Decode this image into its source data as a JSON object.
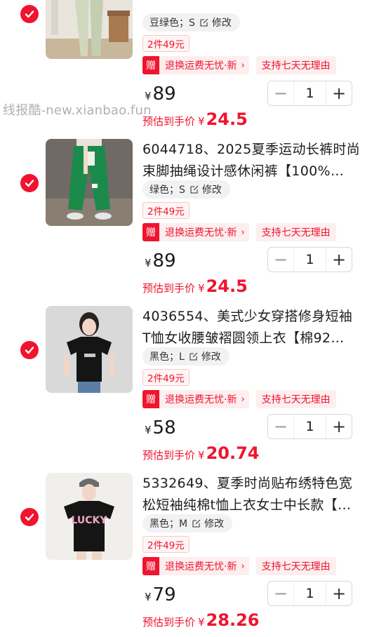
{
  "watermark": "线报酷-new.xianbao.fun",
  "common": {
    "promo": "2件49元",
    "service_badge": "赠",
    "service_label": "退换运费无忧·新",
    "service_chevron": "›",
    "refund_label": "支持七天无理由",
    "currency": "¥",
    "estimate_label": "预估到手价",
    "minus": "−",
    "plus": "+"
  },
  "items": [
    {
      "title_line1": "",
      "title_line2": "",
      "sku": "豆绿色；S",
      "price": "89",
      "estimate": "24.5",
      "quantity": "1",
      "thumb_icon": "wide-leg-pants-photo"
    },
    {
      "title_line1": "6044718、2025夏季运动长裤时尚",
      "title_line2": "束脚抽绳设计感休闲裤【100%…",
      "sku": "绿色；S",
      "price": "89",
      "estimate": "24.5",
      "quantity": "1",
      "thumb_icon": "green-jogger-photo"
    },
    {
      "title_line1": "4036554、美式少女穿搭修身短袖",
      "title_line2": "T恤女收腰皱褶圆领上衣【棉92…",
      "sku": "黑色；L",
      "price": "58",
      "estimate": "20.74",
      "quantity": "1",
      "thumb_icon": "black-tee-photo"
    },
    {
      "title_line1": "5332649、夏季时尚贴布绣特色宽",
      "title_line2": "松短袖纯棉t恤上衣女士中长款【…",
      "sku": "黑色；M",
      "price": "79",
      "estimate": "28.26",
      "quantity": "1",
      "thumb_icon": "lucky-tee-photo"
    }
  ],
  "sku_edit_label": "修改",
  "colors": {
    "accent": "#f0142e",
    "tag_bg": "#fdeeef"
  }
}
